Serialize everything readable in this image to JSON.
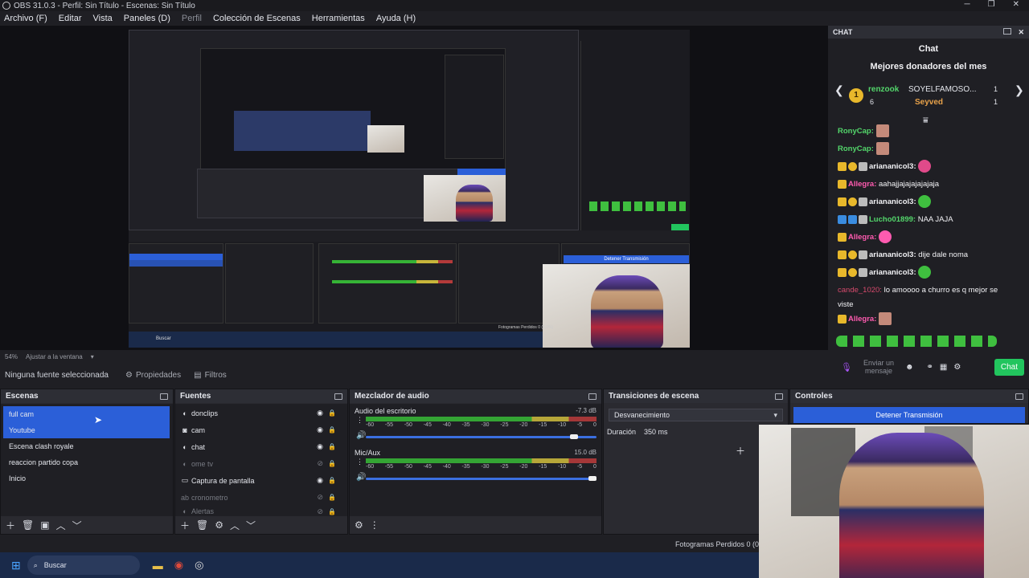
{
  "window": {
    "title": "OBS 31.0.3 - Perfil: Sin Título - Escenas: Sin Título"
  },
  "menu": [
    {
      "label": "Archivo (F)",
      "disabled": false
    },
    {
      "label": "Editar",
      "disabled": false
    },
    {
      "label": "Vista",
      "disabled": false
    },
    {
      "label": "Paneles (D)",
      "disabled": false
    },
    {
      "label": "Perfil",
      "disabled": true
    },
    {
      "label": "Colección de Escenas",
      "disabled": false
    },
    {
      "label": "Herramientas",
      "disabled": false
    },
    {
      "label": "Ayuda (H)",
      "disabled": false
    }
  ],
  "preview": {
    "zoom": "54%",
    "fit_label": "Ajustar a la ventana",
    "inner_stop_label": "Detener Transmisión",
    "inner_frames": "Fotogramas Perdidos 0 (0,0%)",
    "inner_search": "Buscar"
  },
  "sourcebar": {
    "no_source": "Ninguna fuente seleccionada",
    "properties": "Propiedades",
    "filters": "Filtros"
  },
  "scenes": {
    "title": "Escenas",
    "items": [
      "full cam",
      "Youtube",
      "Escena clash royale",
      "reaccion partido copa",
      "Inicio"
    ]
  },
  "sources": {
    "title": "Fuentes",
    "items": [
      {
        "label": "donclips",
        "icon": "browser-icon"
      },
      {
        "label": "cam",
        "icon": "camera-icon"
      },
      {
        "label": "chat",
        "icon": "browser-icon"
      },
      {
        "label": "ome tv",
        "icon": "browser-icon"
      },
      {
        "label": "Captura de pantalla",
        "icon": "monitor-icon"
      },
      {
        "label": "cronometro",
        "icon": "text-icon"
      },
      {
        "label": "Alertas",
        "icon": "browser-icon"
      }
    ]
  },
  "mixer": {
    "title": "Mezclador de audio",
    "channels": [
      {
        "name": "Audio del escritorio",
        "db": "-7.3 dB",
        "volume": 0.92
      },
      {
        "name": "Mic/Aux",
        "db": "15.0 dB",
        "volume": 1.0
      }
    ],
    "ticks": [
      "-60",
      "-55",
      "-50",
      "-45",
      "-40",
      "-35",
      "-30",
      "-25",
      "-20",
      "-15",
      "-10",
      "-5",
      "0"
    ]
  },
  "transitions": {
    "title": "Transiciones de escena",
    "selected": "Desvanecimiento",
    "duration_label": "Duración",
    "duration_value": "350 ms"
  },
  "controls": {
    "title": "Controles",
    "stop_label": "Detener Transmisión"
  },
  "status": {
    "frames": "Fotogramas Perdidos 0 (0"
  },
  "chat": {
    "dock_title": "CHAT",
    "title": "Chat",
    "donors_title": "Mejores donadores del mes",
    "donors": [
      {
        "rank": "1",
        "name": "renzook",
        "amount": "6"
      },
      {
        "rank": "",
        "name": "SOYELFAMOSO...",
        "amount": "1"
      },
      {
        "rank": "",
        "name": "Seyved",
        "amount": "1"
      }
    ],
    "messages": [
      {
        "user": "RonyCap:",
        "text": "",
        "color": "green"
      },
      {
        "user": "RonyCap:",
        "text": "",
        "color": "green"
      },
      {
        "user": "ariananicol3:",
        "text": "",
        "color": "white"
      },
      {
        "user": "Allegra:",
        "text": "aahajjajajajajajaja",
        "color": "pink"
      },
      {
        "user": "ariananicol3:",
        "text": "",
        "color": "white"
      },
      {
        "user": "Lucho01899:",
        "text": "NAA JAJA",
        "color": "green"
      },
      {
        "user": "Allegra:",
        "text": "",
        "color": "pink"
      },
      {
        "user": "ariananicol3:",
        "text": "dije dale noma",
        "color": "white"
      },
      {
        "user": "ariananicol3:",
        "text": "",
        "color": "white"
      },
      {
        "user": "cande_1020:",
        "text": "lo amoooo a churro es q mejor se",
        "color": "red"
      },
      {
        "user": "",
        "text": "viste",
        "color": "white"
      },
      {
        "user": "Allegra:",
        "text": "",
        "color": "pink"
      }
    ],
    "input_placeholder": "Enviar un mensaje",
    "send_label": "Chat"
  },
  "taskbar": {
    "search": "Buscar"
  },
  "colors": {
    "accent": "#2b5fd8",
    "chat_green": "#22c55e"
  }
}
